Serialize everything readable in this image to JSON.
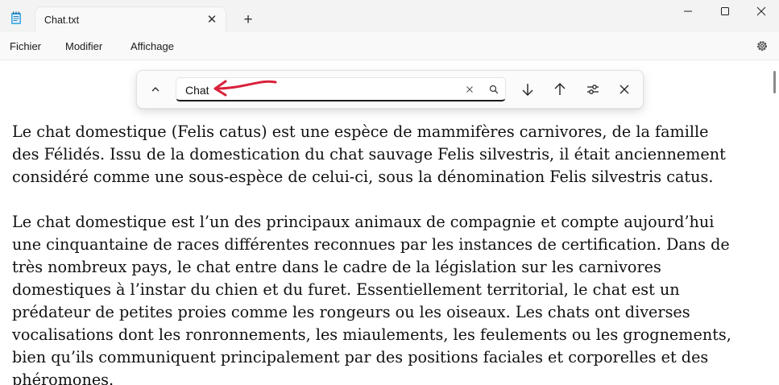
{
  "tab": {
    "title": "Chat.txt",
    "close_glyph": "✕",
    "new_tab_glyph": "+"
  },
  "menu": {
    "items": [
      "Fichier",
      "Modifier",
      "Affichage"
    ]
  },
  "find": {
    "value": "Chat"
  },
  "document": {
    "paragraphs": [
      [
        "Le chat domestique (Felis catus) est une espèce de mammifères carnivores, de la famille",
        "des Félidés. Issu de la domestication du chat sauvage Felis silvestris, il était anciennement",
        "considéré comme une sous-espèce de celui-ci, sous la dénomination Felis silvestris catus."
      ],
      [
        "Le chat domestique est l’un des principaux animaux de compagnie et compte aujourd’hui",
        "une cinquantaine de races différentes reconnues par les instances de certification. Dans de",
        "très nombreux pays, le chat entre dans le cadre de la législation sur les carnivores",
        "domestiques à l’instar du chien et du furet. Essentiellement territorial, le chat est un",
        "prédateur de petites proies comme les rongeurs ou les oiseaux. Les chats ont diverses",
        "vocalisations dont les ronronnements, les miaulements, les feulements ou les grognements,",
        "bien qu’ils communiquent principalement par des positions faciales et corporelles et des",
        "phéromones."
      ]
    ]
  },
  "colors": {
    "annotation_arrow": "#d9213a",
    "tab_bar": "#f3f3f3"
  },
  "icons": [
    "notepad-icon",
    "minimize-icon",
    "maximize-icon",
    "close-icon",
    "settings-gear-icon",
    "chevron-up-icon",
    "clear-icon",
    "search-icon",
    "arrow-down-icon",
    "arrow-up-icon",
    "options-sliders-icon"
  ]
}
